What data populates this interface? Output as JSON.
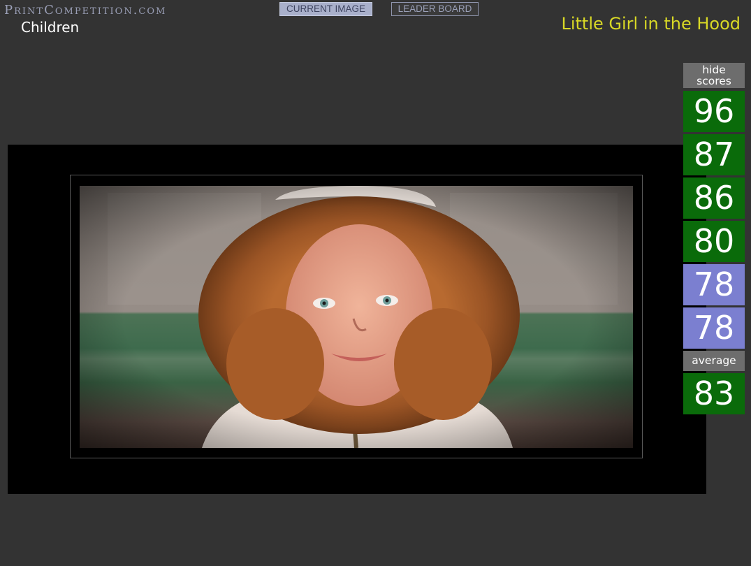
{
  "header": {
    "brand": "PrintCompetition.com",
    "category": "Children",
    "current_image_label": "CURRENT IMAGE",
    "leader_board_label": "LEADER BOARD",
    "image_title": "Little Girl in the Hood"
  },
  "scores": {
    "hide_label_line1": "hide",
    "hide_label_line2": "scores",
    "judge_scores": [
      {
        "value": "96",
        "color": "#0a6b0a"
      },
      {
        "value": "87",
        "color": "#0a6b0a"
      },
      {
        "value": "86",
        "color": "#0a6b0a"
      },
      {
        "value": "80",
        "color": "#0a6b0a"
      },
      {
        "value": "78",
        "color": "#7b7fd0"
      },
      {
        "value": "78",
        "color": "#7b7fd0"
      }
    ],
    "average_label": "average",
    "average_value": "83"
  },
  "colors": {
    "background": "#333333",
    "title_yellow": "#d8d826",
    "score_green": "#0a6b0a",
    "score_purple": "#7b7fd0"
  }
}
